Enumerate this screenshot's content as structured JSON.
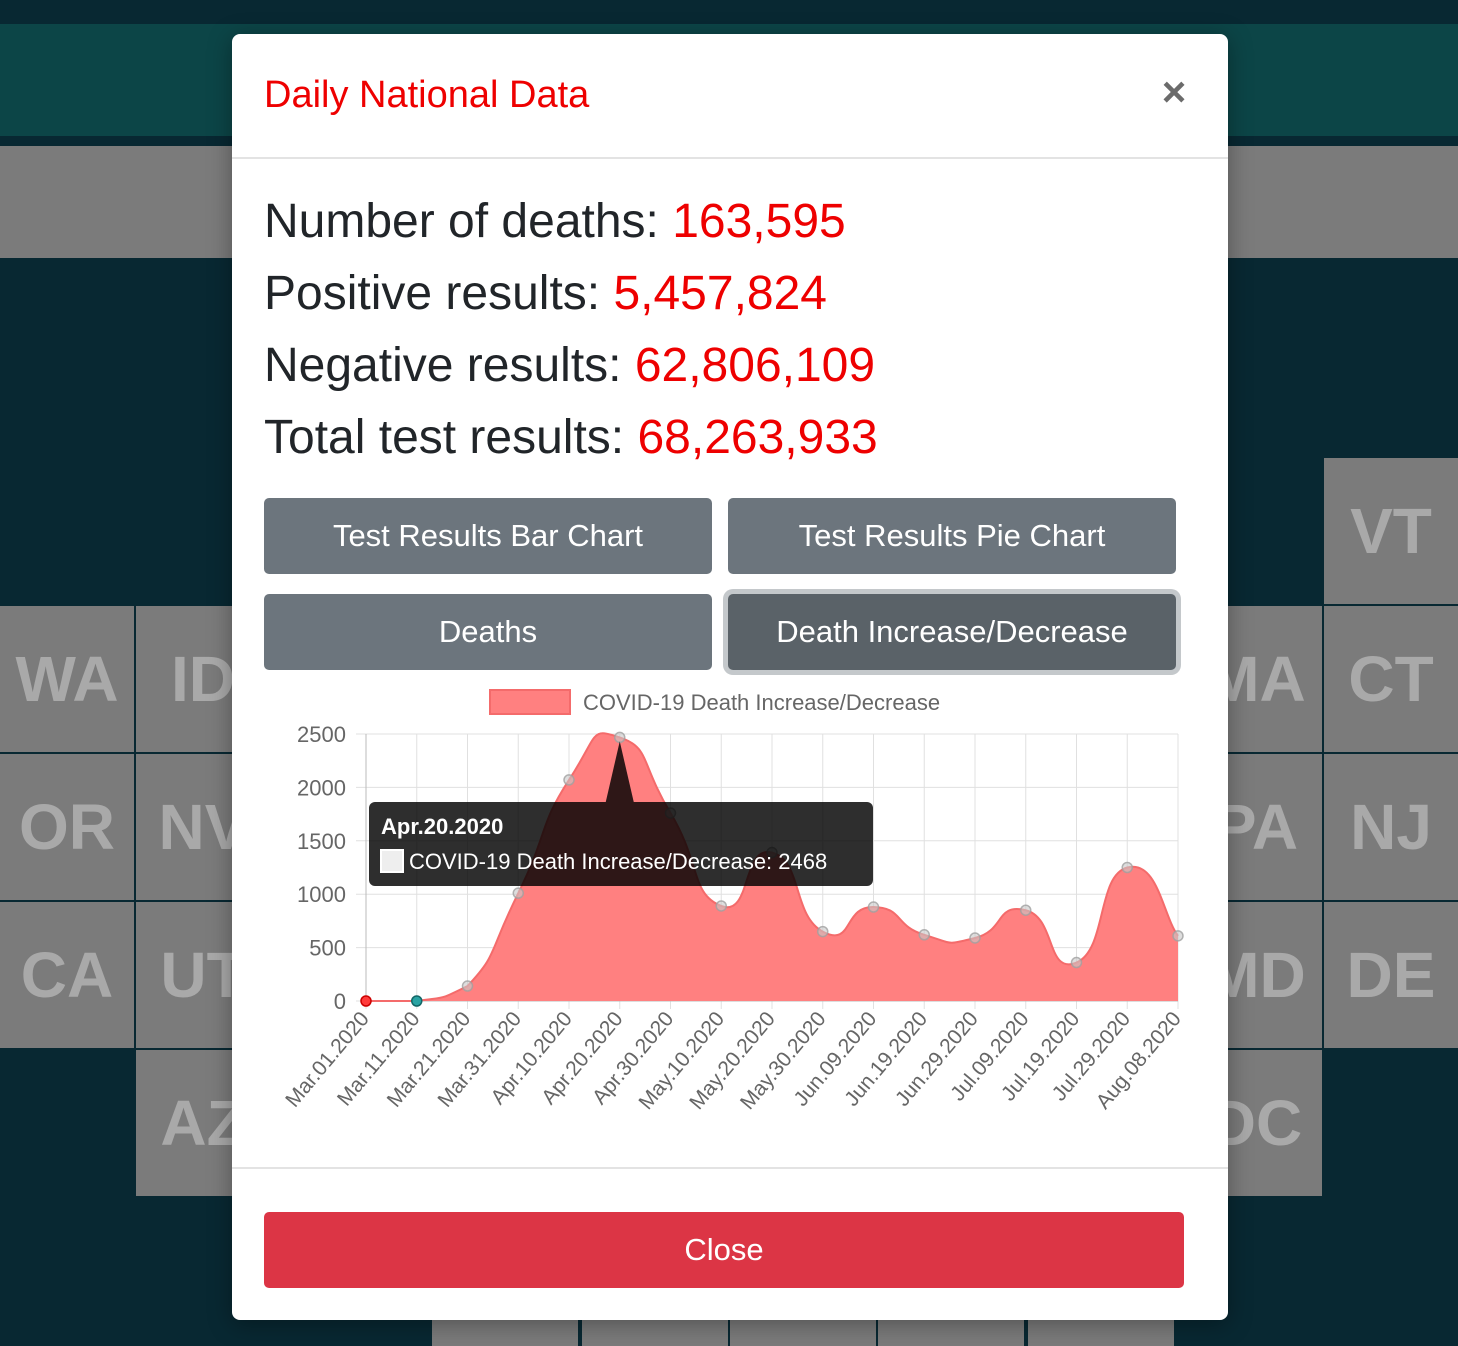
{
  "background": {
    "tiles": [
      {
        "label": "WA"
      },
      {
        "label": "ID"
      },
      {
        "label": "OR"
      },
      {
        "label": "NV"
      },
      {
        "label": "CA"
      },
      {
        "label": "UT"
      },
      {
        "label": "AZ"
      },
      {
        "label": "VT"
      },
      {
        "label": "MA"
      },
      {
        "label": "CT"
      },
      {
        "label": "PA"
      },
      {
        "label": "NJ"
      },
      {
        "label": "MD"
      },
      {
        "label": "DE"
      },
      {
        "label": "DC"
      }
    ]
  },
  "modal": {
    "title": "Daily National Data",
    "close_icon": "×",
    "stats": [
      {
        "label": "Number of deaths: ",
        "value": "163,595"
      },
      {
        "label": "Positive results: ",
        "value": "5,457,824"
      },
      {
        "label": "Negative results: ",
        "value": "62,806,109"
      },
      {
        "label": "Total test results: ",
        "value": "68,263,933"
      }
    ],
    "buttons": {
      "bar_chart": "Test Results Bar Chart",
      "pie_chart": "Test Results Pie Chart",
      "deaths": "Deaths",
      "death_change": "Death Increase/Decrease"
    },
    "close_label": "Close"
  },
  "colors": {
    "accent": "#ee0000",
    "series_fill": "#ff8080",
    "series_line": "#f46b6b",
    "button": "#6c757d",
    "close_button": "#dc3545"
  },
  "chart_data": {
    "type": "area",
    "legend": "COVID-19 Death Increase/Decrease",
    "x": [
      "Mar.01.2020",
      "Mar.11.2020",
      "Mar.21.2020",
      "Mar.31.2020",
      "Apr.10.2020",
      "Apr.20.2020",
      "Apr.30.2020",
      "May.10.2020",
      "May.20.2020",
      "May.30.2020",
      "Jun.09.2020",
      "Jun.19.2020",
      "Jun.29.2020",
      "Jul.09.2020",
      "Jul.19.2020",
      "Jul.29.2020",
      "Aug.08.2020"
    ],
    "series": [
      {
        "name": "COVID-19 Death Increase/Decrease",
        "values": [
          0,
          0,
          140,
          1010,
          2070,
          2468,
          1760,
          890,
          1390,
          650,
          880,
          620,
          590,
          850,
          360,
          1250,
          610
        ]
      }
    ],
    "ylim": [
      0,
      2500
    ],
    "yticks": [
      0,
      500,
      1000,
      1500,
      2000,
      2500
    ],
    "grid": true,
    "legend_position": "top",
    "tooltip": {
      "title": "Apr.20.2020",
      "text": "COVID-19 Death Increase/Decrease: 2468"
    }
  }
}
